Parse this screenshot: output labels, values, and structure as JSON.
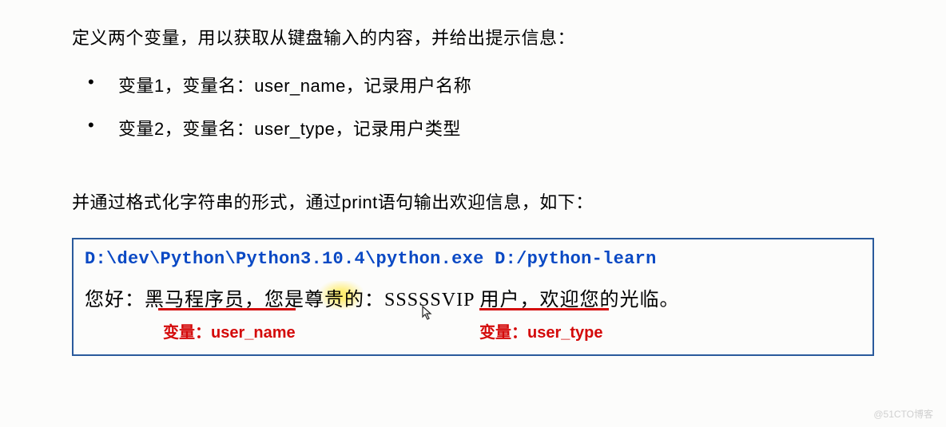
{
  "intro": "定义两个变量，用以获取从键盘输入的内容，并给出提示信息：",
  "bullets": [
    "变量1，变量名：user_name，记录用户名称",
    "变量2，变量名：user_type，记录用户类型"
  ],
  "para2": "并通过格式化字符串的形式，通过print语句输出欢迎信息，如下：",
  "output": {
    "cmd": "D:\\dev\\Python\\Python3.10.4\\python.exe D:/python-learn",
    "line_prefix": "您好：",
    "user_name_value": "黑马程序员",
    "mid1": "，您是尊",
    "highlight": "贵",
    "mid2": "的：",
    "user_type_value": "SSSSSVIP",
    "suffix": " 用户，欢迎您的光临。"
  },
  "annotations": {
    "label1": "变量：user_name",
    "label2": "变量：user_type"
  },
  "watermark": "@51CTO博客"
}
